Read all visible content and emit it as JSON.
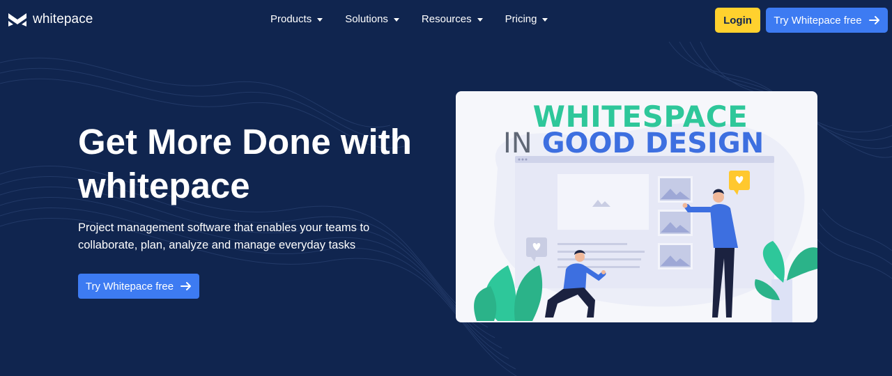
{
  "nav": {
    "logo_text": "whitepace",
    "menu": [
      {
        "label": "Products"
      },
      {
        "label": "Solutions"
      },
      {
        "label": "Resources"
      },
      {
        "label": "Pricing"
      }
    ],
    "login_label": "Login",
    "try_label": "Try Whitepace free"
  },
  "hero": {
    "title_line1": "Get More Done with",
    "title_line2": "whitepace",
    "subtitle_line1": "Project management software that enables your teams to",
    "subtitle_line2": "collaborate, plan, analyze and manage everyday tasks",
    "cta_label": "Try Whitepace free"
  },
  "illustration": {
    "line1": "WHITESPACE",
    "line2a": "IN",
    "line2b": "GOOD DESIGN"
  },
  "colors": {
    "background": "#10254f",
    "accent_blue": "#3d7bf2",
    "accent_yellow": "#ffd12e",
    "illustration_green": "#2ec79a"
  }
}
